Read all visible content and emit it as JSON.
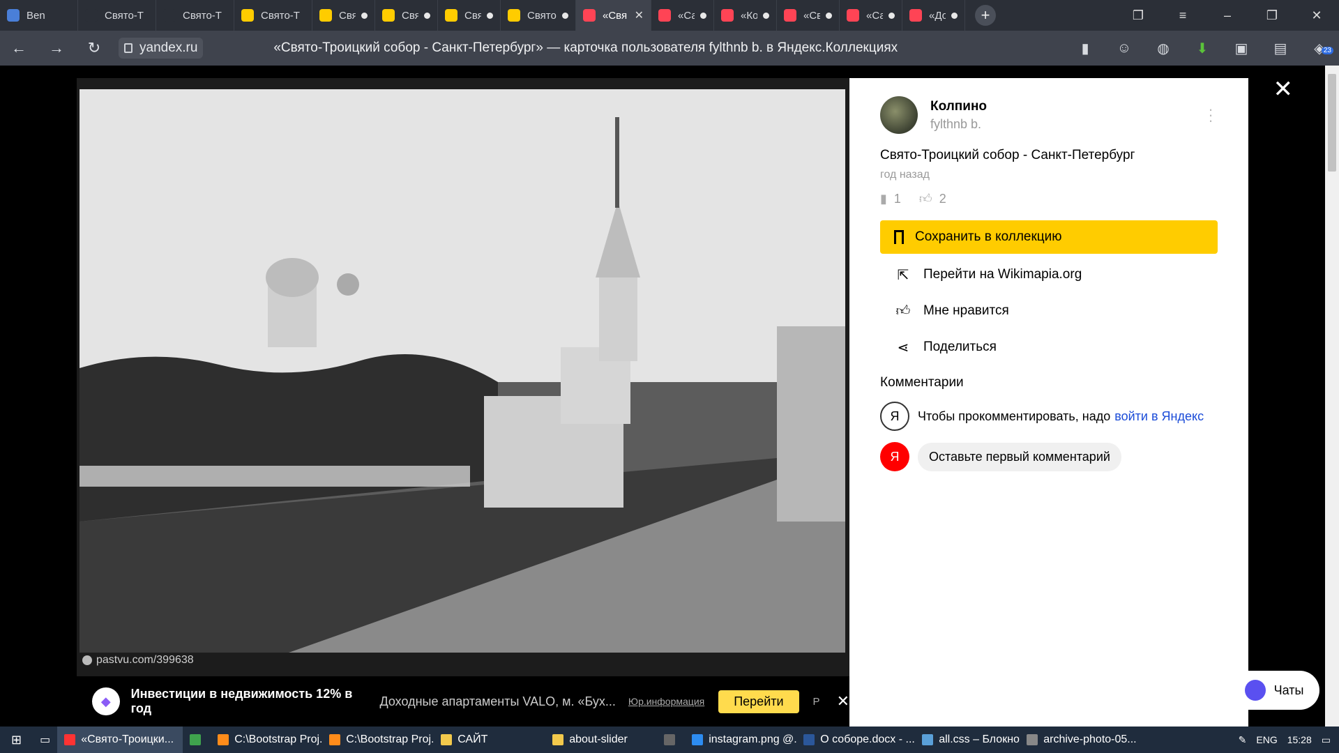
{
  "tabs": [
    {
      "title": "Ben",
      "icon": "play",
      "color": "#4a7fd8"
    },
    {
      "title": "Свято-Т",
      "icon": "page",
      "color": "#2b2f37"
    },
    {
      "title": "Свято-Т",
      "icon": "yandex",
      "color": "#2b2f37"
    },
    {
      "title": "Свято-Т",
      "icon": "collections",
      "color": "#ffcc00"
    },
    {
      "title": "Свят",
      "icon": "collections",
      "color": "#ffcc00"
    },
    {
      "title": "Свят",
      "icon": "collections",
      "color": "#ffcc00"
    },
    {
      "title": "Свят",
      "icon": "collections",
      "color": "#ffcc00"
    },
    {
      "title": "Свято-Т",
      "icon": "collections",
      "color": "#ffcc00"
    },
    {
      "title": "«Свя",
      "icon": "collections-red",
      "color": "#ff4455"
    },
    {
      "title": "«Сан",
      "icon": "collections-red",
      "color": "#ff4455"
    },
    {
      "title": "«Кол",
      "icon": "collections-red",
      "color": "#ff4455"
    },
    {
      "title": "«Свя",
      "icon": "collections-red",
      "color": "#ff4455"
    },
    {
      "title": "«Сан",
      "icon": "collections-red",
      "color": "#ff4455"
    },
    {
      "title": "«Дор",
      "icon": "collections-red",
      "color": "#ff4455"
    }
  ],
  "address": {
    "domain": "yandex.ru",
    "page_title": "«Свято-Троицкий собор - Санкт-Петербург» — карточка пользователя fylthnb b. в Яндекс.Коллекциях",
    "extension_badge": "23"
  },
  "photo": {
    "credit": "pastvu.com/399638"
  },
  "ad": {
    "headline": "Инвестиции в недвижимость 12% в год",
    "description": "Доходные апартаменты VALO, м. «Бух...",
    "legal": "Юр.информация",
    "go_label": "Перейти",
    "r_label": "Р"
  },
  "card": {
    "user_name": "Колпино",
    "user_login": "fylthnb b.",
    "title": "Свято-Троицкий собор - Санкт-Петербург",
    "time_ago": "год назад",
    "saves_count": "1",
    "likes_count": "2",
    "save_button": "Сохранить в коллекцию",
    "actions": [
      {
        "label": "Перейти на Wikimapia.org",
        "icon": "external-link"
      },
      {
        "label": "Мне нравится",
        "icon": "thumbs-up"
      },
      {
        "label": "Поделиться",
        "icon": "share"
      }
    ],
    "comments_heading": "Комментарии",
    "comment_prompt": "Чтобы прокомментировать, надо",
    "login_link": "войти в Яндекс",
    "first_comment": "Оставьте первый комментарий",
    "yandex_letter": "Я"
  },
  "chats_label": "Чаты",
  "taskbar": [
    {
      "title": "«Свято-Троицки...",
      "color": "#ff3333",
      "active": true
    },
    {
      "title": "",
      "color": "#3fa34d",
      "active": false
    },
    {
      "title": "C:\\Bootstrap Proj...",
      "color": "#ff8c1a",
      "active": false
    },
    {
      "title": "C:\\Bootstrap Proj...",
      "color": "#ff8c1a",
      "active": false
    },
    {
      "title": "САЙТ",
      "color": "#f2c94c",
      "active": false
    },
    {
      "title": "about-slider",
      "color": "#f2c94c",
      "active": false
    },
    {
      "title": "",
      "color": "#666666",
      "active": false
    },
    {
      "title": "instagram.png @...",
      "color": "#2d8cf0",
      "active": false
    },
    {
      "title": "О соборе.docx - ...",
      "color": "#2b579a",
      "active": false
    },
    {
      "title": "all.css – Блокнот",
      "color": "#5aa0d8",
      "active": false
    },
    {
      "title": "archive-photo-05...",
      "color": "#888888",
      "active": false
    }
  ],
  "tray": {
    "lang": "ENG",
    "time": "15:28"
  }
}
